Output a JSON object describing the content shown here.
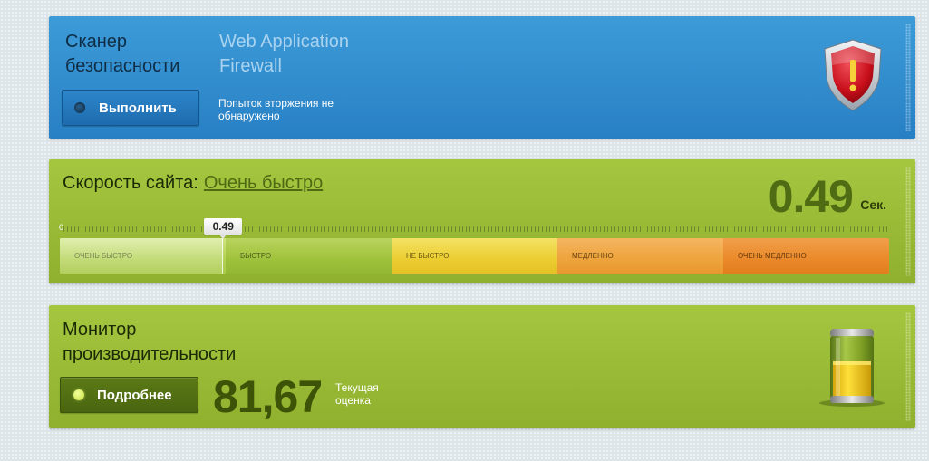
{
  "scanner": {
    "title_line1": "Сканер",
    "title_line2": "безопасности",
    "waf_line1": "Web Application",
    "waf_line2": "Firewall",
    "run_label": "Выполнить",
    "status_text": "Попыток вторжения не обнаружено",
    "icon": "shield-alert-icon"
  },
  "speed": {
    "title": "Скорость сайта:",
    "rating": "Очень быстро",
    "value": "0.49",
    "unit": "Сек.",
    "scale_start": "0",
    "marker_value": "0.49",
    "marker_fraction": 0.197,
    "segments": [
      {
        "label": "Очень быстро"
      },
      {
        "label": "Быстро"
      },
      {
        "label": "Не быстро"
      },
      {
        "label": "Медленно"
      },
      {
        "label": "Очень медленно"
      }
    ]
  },
  "monitor": {
    "title_line1": "Монитор",
    "title_line2": "производительности",
    "details_label": "Подробнее",
    "score": "81,67",
    "score_label": "Текущая оценка",
    "icon": "battery-icon"
  },
  "colors": {
    "blue_panel": "#2f8ccd",
    "green_panel": "#9bbd38",
    "speed_number": "#4f6b14"
  }
}
